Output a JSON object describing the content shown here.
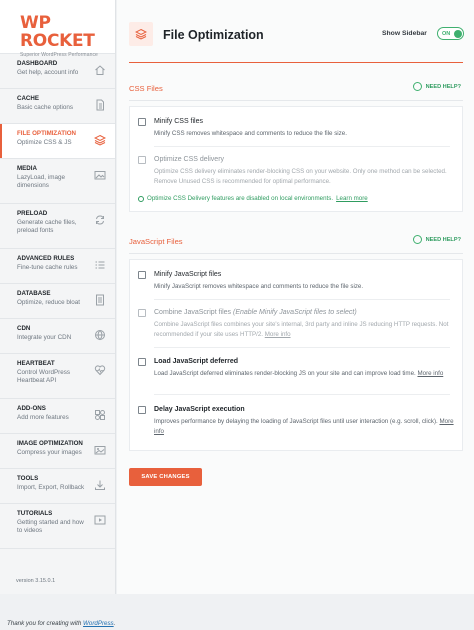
{
  "logo": {
    "name": "WP ROCKET",
    "tagline": "Superior WordPress Performance"
  },
  "sidebar": {
    "items": [
      {
        "title": "DASHBOARD",
        "desc": "Get help, account info",
        "icon": "home-icon"
      },
      {
        "title": "CACHE",
        "desc": "Basic cache options",
        "icon": "file-icon"
      },
      {
        "title": "FILE OPTIMIZATION",
        "desc": "Optimize CSS & JS",
        "icon": "layers-icon",
        "active": true
      },
      {
        "title": "MEDIA",
        "desc": "LazyLoad, image dimensions",
        "icon": "image-icon"
      },
      {
        "title": "PRELOAD",
        "desc": "Generate cache files, preload fonts",
        "icon": "refresh-icon"
      },
      {
        "title": "ADVANCED RULES",
        "desc": "Fine-tune cache rules",
        "icon": "list-icon"
      },
      {
        "title": "DATABASE",
        "desc": "Optimize, reduce bloat",
        "icon": "database-icon"
      },
      {
        "title": "CDN",
        "desc": "Integrate your CDN",
        "icon": "globe-icon"
      },
      {
        "title": "HEARTBEAT",
        "desc": "Control WordPress Heartbeat API",
        "icon": "heartbeat-icon"
      },
      {
        "title": "ADD-ONS",
        "desc": "Add more features",
        "icon": "addons-icon"
      },
      {
        "title": "IMAGE OPTIMIZATION",
        "desc": "Compress your images",
        "icon": "image-opt-icon"
      },
      {
        "title": "TOOLS",
        "desc": "Import, Export, Rollback",
        "icon": "download-icon"
      },
      {
        "title": "TUTORIALS",
        "desc": "Getting started and how to videos",
        "icon": "video-icon"
      }
    ],
    "version": "version 3.15.0.1"
  },
  "header": {
    "title": "File Optimization",
    "show_sidebar_label": "Show Sidebar",
    "toggle_label": "ON"
  },
  "css_section": {
    "title": "CSS Files",
    "help": "NEED HELP?",
    "options": [
      {
        "title": "Minify CSS files",
        "desc": "Minify CSS removes whitespace and comments to reduce the file size.",
        "checked": false,
        "disabled": false
      },
      {
        "title": "Optimize CSS delivery",
        "desc": "Optimize CSS delivery eliminates render-blocking CSS on your website. Only one method can be selected. Remove Unused CSS is recommended for optimal performance.",
        "checked": false,
        "disabled": true
      }
    ],
    "notice": "Optimize CSS Delivery features are disabled on local environments.",
    "notice_link": "Learn more"
  },
  "js_section": {
    "title": "JavaScript Files",
    "help": "NEED HELP?",
    "options": [
      {
        "title": "Minify JavaScript files",
        "desc": "Minify JavaScript removes whitespace and comments to reduce the file size.",
        "disabled": false
      },
      {
        "title": "Combine JavaScript files",
        "title_note": "(Enable Minify JavaScript files to select)",
        "desc": "Combine JavaScript files combines your site's internal, 3rd party and inline JS reducing HTTP requests. Not recommended if your site uses HTTP/2.",
        "more": "More info",
        "disabled": true
      },
      {
        "title": "Load JavaScript deferred",
        "desc": "Load JavaScript deferred eliminates render-blocking JS on your site and can improve load time.",
        "more": "More info",
        "disabled": false
      },
      {
        "title": "Delay JavaScript execution",
        "desc": "Improves performance by delaying the loading of JavaScript files until user interaction (e.g. scroll, click).",
        "more": "More info",
        "disabled": false
      }
    ]
  },
  "save_button": "SAVE CHANGES",
  "footer": {
    "text": "Thank you for creating with",
    "link": "WordPress",
    "end": "."
  },
  "colors": {
    "accent": "#e8603c",
    "success": "#3fb06f"
  }
}
